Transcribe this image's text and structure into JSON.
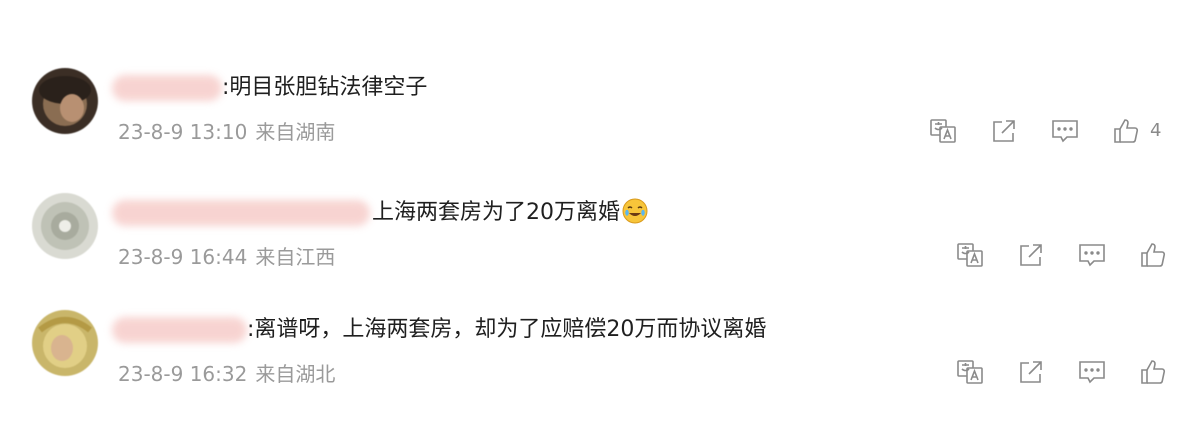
{
  "comments": [
    {
      "text": ":明目张胆钻法律空子",
      "date": "23-8-9 13:10",
      "location": "来自湖南",
      "likes": "4",
      "emoji": ""
    },
    {
      "text": "上海两套房为了20万离婚",
      "date": "23-8-9 16:44",
      "location": "来自江西",
      "likes": "",
      "emoji": "laughing-crying-emoji"
    },
    {
      "text": ":离谱呀，上海两套房，却为了应赔偿20万而协议离婚",
      "date": "23-8-9 16:32",
      "location": "来自湖北",
      "likes": "",
      "emoji": ""
    }
  ],
  "icons": {
    "translate": "translate-icon",
    "share": "share-icon",
    "reply": "comment-icon",
    "like": "thumbs-up-icon"
  },
  "colors": {
    "text": "#1f1f1f",
    "meta": "#9a9a9a",
    "icon": "#8a8a8a"
  }
}
